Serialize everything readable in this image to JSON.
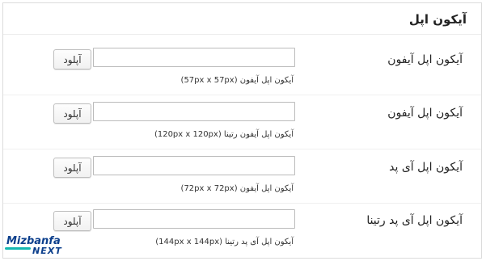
{
  "panel": {
    "title": "آیکون اپل"
  },
  "rows": [
    {
      "label": "آیکون اپل آیفون",
      "input_value": "",
      "button_label": "آپلود",
      "hint": "آیکون اپل آیفون (57px x 57px)"
    },
    {
      "label": "آیکون اپل آیفون",
      "input_value": "",
      "button_label": "آپلود",
      "hint": "آیکون اپل آیفون رتینا (120px x 120px)"
    },
    {
      "label": "آیکون اپل آی پد",
      "input_value": "",
      "button_label": "آپلود",
      "hint": "آیکون اپل آیفون (72px x 72px)"
    },
    {
      "label": "آیکون اپل آی پد رتینا",
      "input_value": "",
      "button_label": "آپلود",
      "hint": "آیکون اپل آی پد رتینا (144px x 144px)"
    }
  ],
  "watermark": {
    "line1": "Mizbanfa",
    "line2": "NEXT"
  },
  "colors": {
    "border": "#dcdcdc",
    "logo_blue": "#0c3f8c",
    "logo_teal": "#14b8b2"
  }
}
